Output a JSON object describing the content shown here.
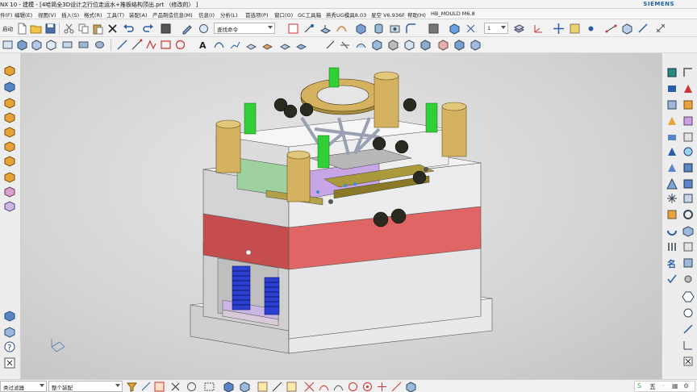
{
  "window": {
    "title": "NX 10 - 建模 - [4哈简全3D设计之行位走运水+推板结构顶出.prt （修改的） ]",
    "brand": "SIEMENS"
  },
  "menubar": {
    "items": [
      "件(F)",
      "编辑(E)",
      "视图(V)",
      "插入(S)",
      "格式(R)",
      "工具(T)",
      "装配(A)",
      "产品制造信息(M)",
      "信息(I)",
      "分析(L)",
      "首选项(P)",
      "窗口(O)",
      "GC工具箱",
      "燕秀UG模具8.03",
      "星空 V6.936F",
      "帮助(H)",
      "HB_MOULD M6.8"
    ]
  },
  "toolbar": {
    "start_label": "启动",
    "command_search_placeholder": "查找命令",
    "layer_value": "1"
  },
  "statusbar": {
    "selection_filter": "类过滤器",
    "scope": "整个装配",
    "ime_label": "五"
  },
  "colors": {
    "accent": "#1b5fa8",
    "plate_gray": "#e2e2e2",
    "red_plate": "#d9605f",
    "bronze": "#d4b25f",
    "green_screw": "#2fcf35",
    "spring_blue": "#2c3fd1",
    "dark_part": "#2a2a20"
  },
  "icons": {
    "titlebar": "nx-app-icon",
    "statusbar_ime": "sogou-ime-icon"
  }
}
